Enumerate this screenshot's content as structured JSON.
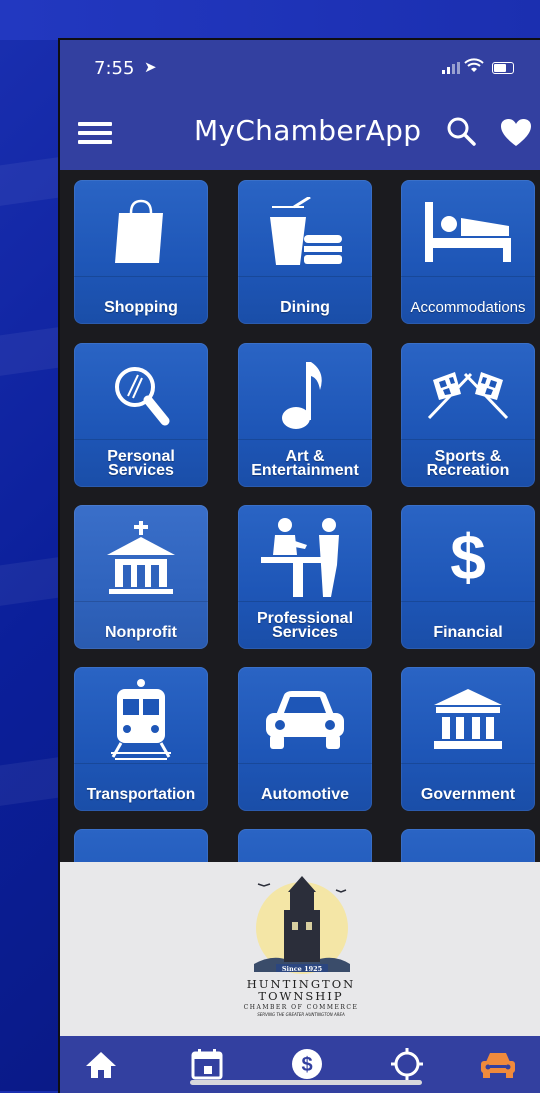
{
  "status_bar": {
    "time": "7:55",
    "location_arrow": "location-arrow-icon"
  },
  "app_bar": {
    "title": "MyChamberApp"
  },
  "categories": [
    {
      "label": "Shopping",
      "icon": "shopping-bag-icon"
    },
    {
      "label": "Dining",
      "icon": "dining-icon"
    },
    {
      "label": "Accommodations",
      "icon": "bed-icon"
    },
    {
      "label_line1": "Personal",
      "label_line2": "Services",
      "icon": "magnifier-icon"
    },
    {
      "label_line1": "Art &",
      "label_line2": "Entertainment",
      "icon": "music-note-icon"
    },
    {
      "label_line1": "Sports &",
      "label_line2": "Recreation",
      "icon": "checkered-flags-icon"
    },
    {
      "label": "Nonprofit",
      "icon": "chapel-icon"
    },
    {
      "label_line1": "Professional",
      "label_line2": "Services",
      "icon": "professional-services-icon"
    },
    {
      "label": "Financial",
      "icon": "dollar-icon"
    },
    {
      "label": "Transportation",
      "icon": "train-icon"
    },
    {
      "label": "Automotive",
      "icon": "car-icon"
    },
    {
      "label": "Government",
      "icon": "government-building-icon"
    }
  ],
  "logo": {
    "badge_text": "Since 1925",
    "line1": "HUNTINGTON",
    "line2": "TOWNSHIP",
    "line3": "CHAMBER OF COMMERCE",
    "line4": "SERVING THE GREATER HUNTINGTON AREA"
  },
  "tabs": [
    {
      "icon": "home-icon",
      "color": "#ffffff"
    },
    {
      "icon": "calendar-icon",
      "color": "#ffffff"
    },
    {
      "icon": "dollar-coin-icon",
      "color": "#ffffff"
    },
    {
      "icon": "target-icon",
      "color": "#ffffff"
    },
    {
      "icon": "car-icon",
      "color": "#f08a3c"
    }
  ],
  "colors": {
    "app_bar": "#3340a0",
    "tile": "#1e56b7",
    "active_tab": "#f08a3c"
  }
}
